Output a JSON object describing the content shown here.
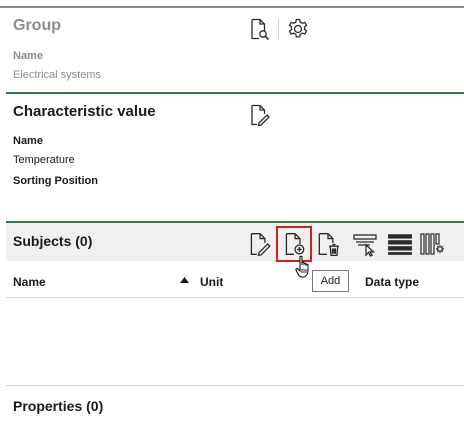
{
  "group": {
    "title": "Group",
    "name_label": "Name",
    "name_value": "Electrical systems"
  },
  "characteristic_value": {
    "title": "Characteristic value",
    "name_label": "Name",
    "name_value": "Temperature",
    "sorting_label": "Sorting Position"
  },
  "subjects": {
    "title": "Subjects (0)",
    "columns": [
      "Name",
      "Unit",
      "Data type"
    ],
    "tooltip": "Add",
    "toolbar_icons": [
      "edit-document-icon",
      "add-document-icon",
      "delete-document-icon",
      "filter-select-icon",
      "list-view-icon",
      "column-settings-icon"
    ]
  },
  "properties": {
    "title": "Properties (0)"
  },
  "colors": {
    "accent_green": "#2e7d4f",
    "highlight_red": "#d21f1f",
    "muted_text": "#8c8c8c"
  }
}
